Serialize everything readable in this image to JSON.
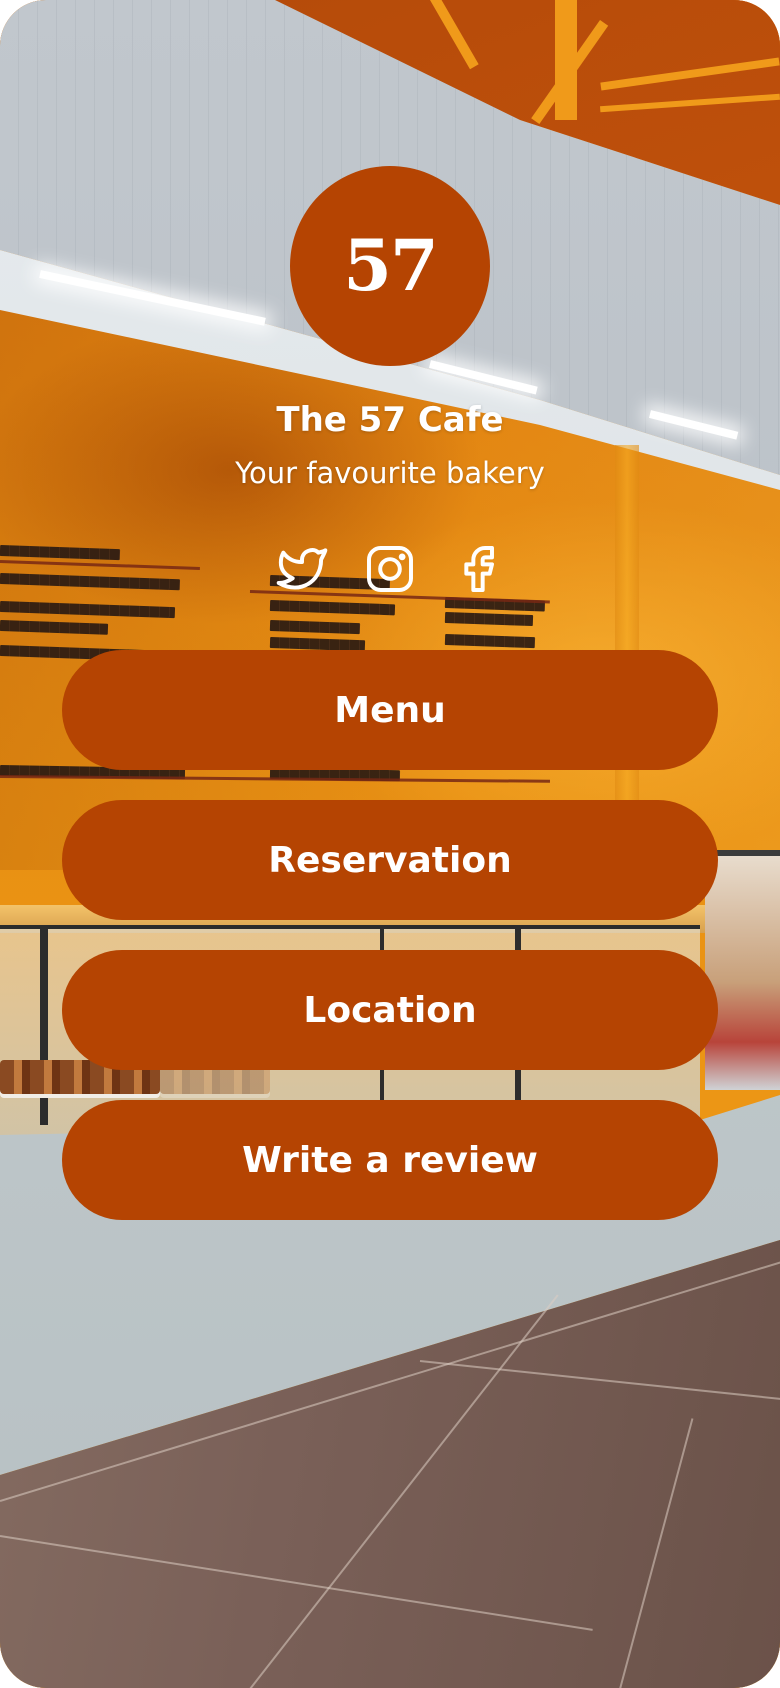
{
  "brand": {
    "logo_text": "57",
    "name": "The 57 Cafe",
    "tagline": "Your favourite bakery",
    "accent_color": "#b54402"
  },
  "socials": [
    {
      "icon": "twitter-icon"
    },
    {
      "icon": "instagram-icon"
    },
    {
      "icon": "facebook-icon"
    }
  ],
  "links": [
    {
      "label": "Menu"
    },
    {
      "label": "Reservation"
    },
    {
      "label": "Location"
    },
    {
      "label": "Write a review"
    }
  ]
}
